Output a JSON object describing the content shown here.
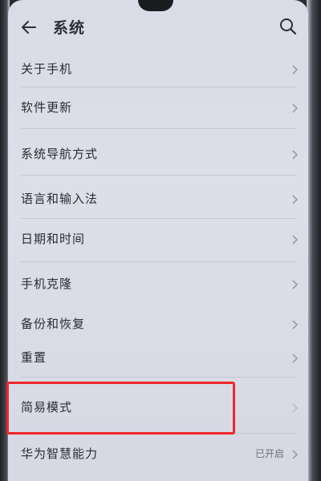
{
  "header": {
    "title": "系统",
    "back_icon": "arrow-left-icon",
    "search_icon": "search-icon"
  },
  "settings": {
    "items": [
      {
        "label": "关于手机"
      },
      {
        "label": "软件更新"
      },
      {
        "label": "系统导航方式"
      },
      {
        "label": "语言和输入法"
      },
      {
        "label": "日期和时间"
      },
      {
        "label": "手机克隆"
      },
      {
        "label": "备份和恢复"
      },
      {
        "label": "重置"
      },
      {
        "label": "简易模式"
      },
      {
        "label": "华为智慧能力",
        "value": "已开启"
      }
    ]
  },
  "annotation": {
    "highlighted_item": "简易模式",
    "highlight_color": "#f2272b"
  }
}
